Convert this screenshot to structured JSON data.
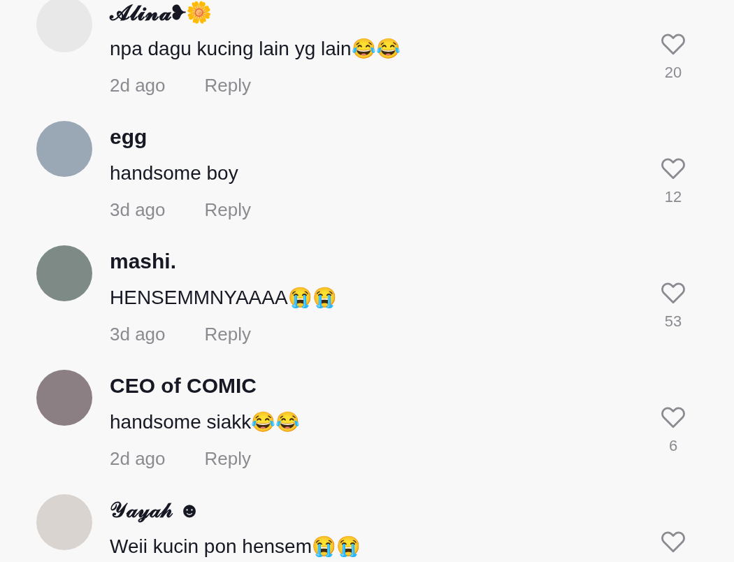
{
  "comments": [
    {
      "username": "𝓐𝓵𝓲𝓷𝓪❥🌼",
      "text": "npa dagu kucing lain yg lain😂😂",
      "time": "2d ago",
      "reply": "Reply",
      "likes": "20"
    },
    {
      "username": "egg",
      "text": "handsome boy",
      "time": "3d ago",
      "reply": "Reply",
      "likes": "12"
    },
    {
      "username": "mashi.",
      "text": "HENSEMMNYAAAA😭😭",
      "time": "3d ago",
      "reply": "Reply",
      "likes": "53"
    },
    {
      "username": "CEO of COMIC",
      "text": "handsome siakk😂😂",
      "time": "2d ago",
      "reply": "Reply",
      "likes": "6"
    },
    {
      "username": "𝒴𝒶𝓎𝒶𝒽 ☻",
      "text": "Weii kucin pon hensem😭😭"
    }
  ]
}
